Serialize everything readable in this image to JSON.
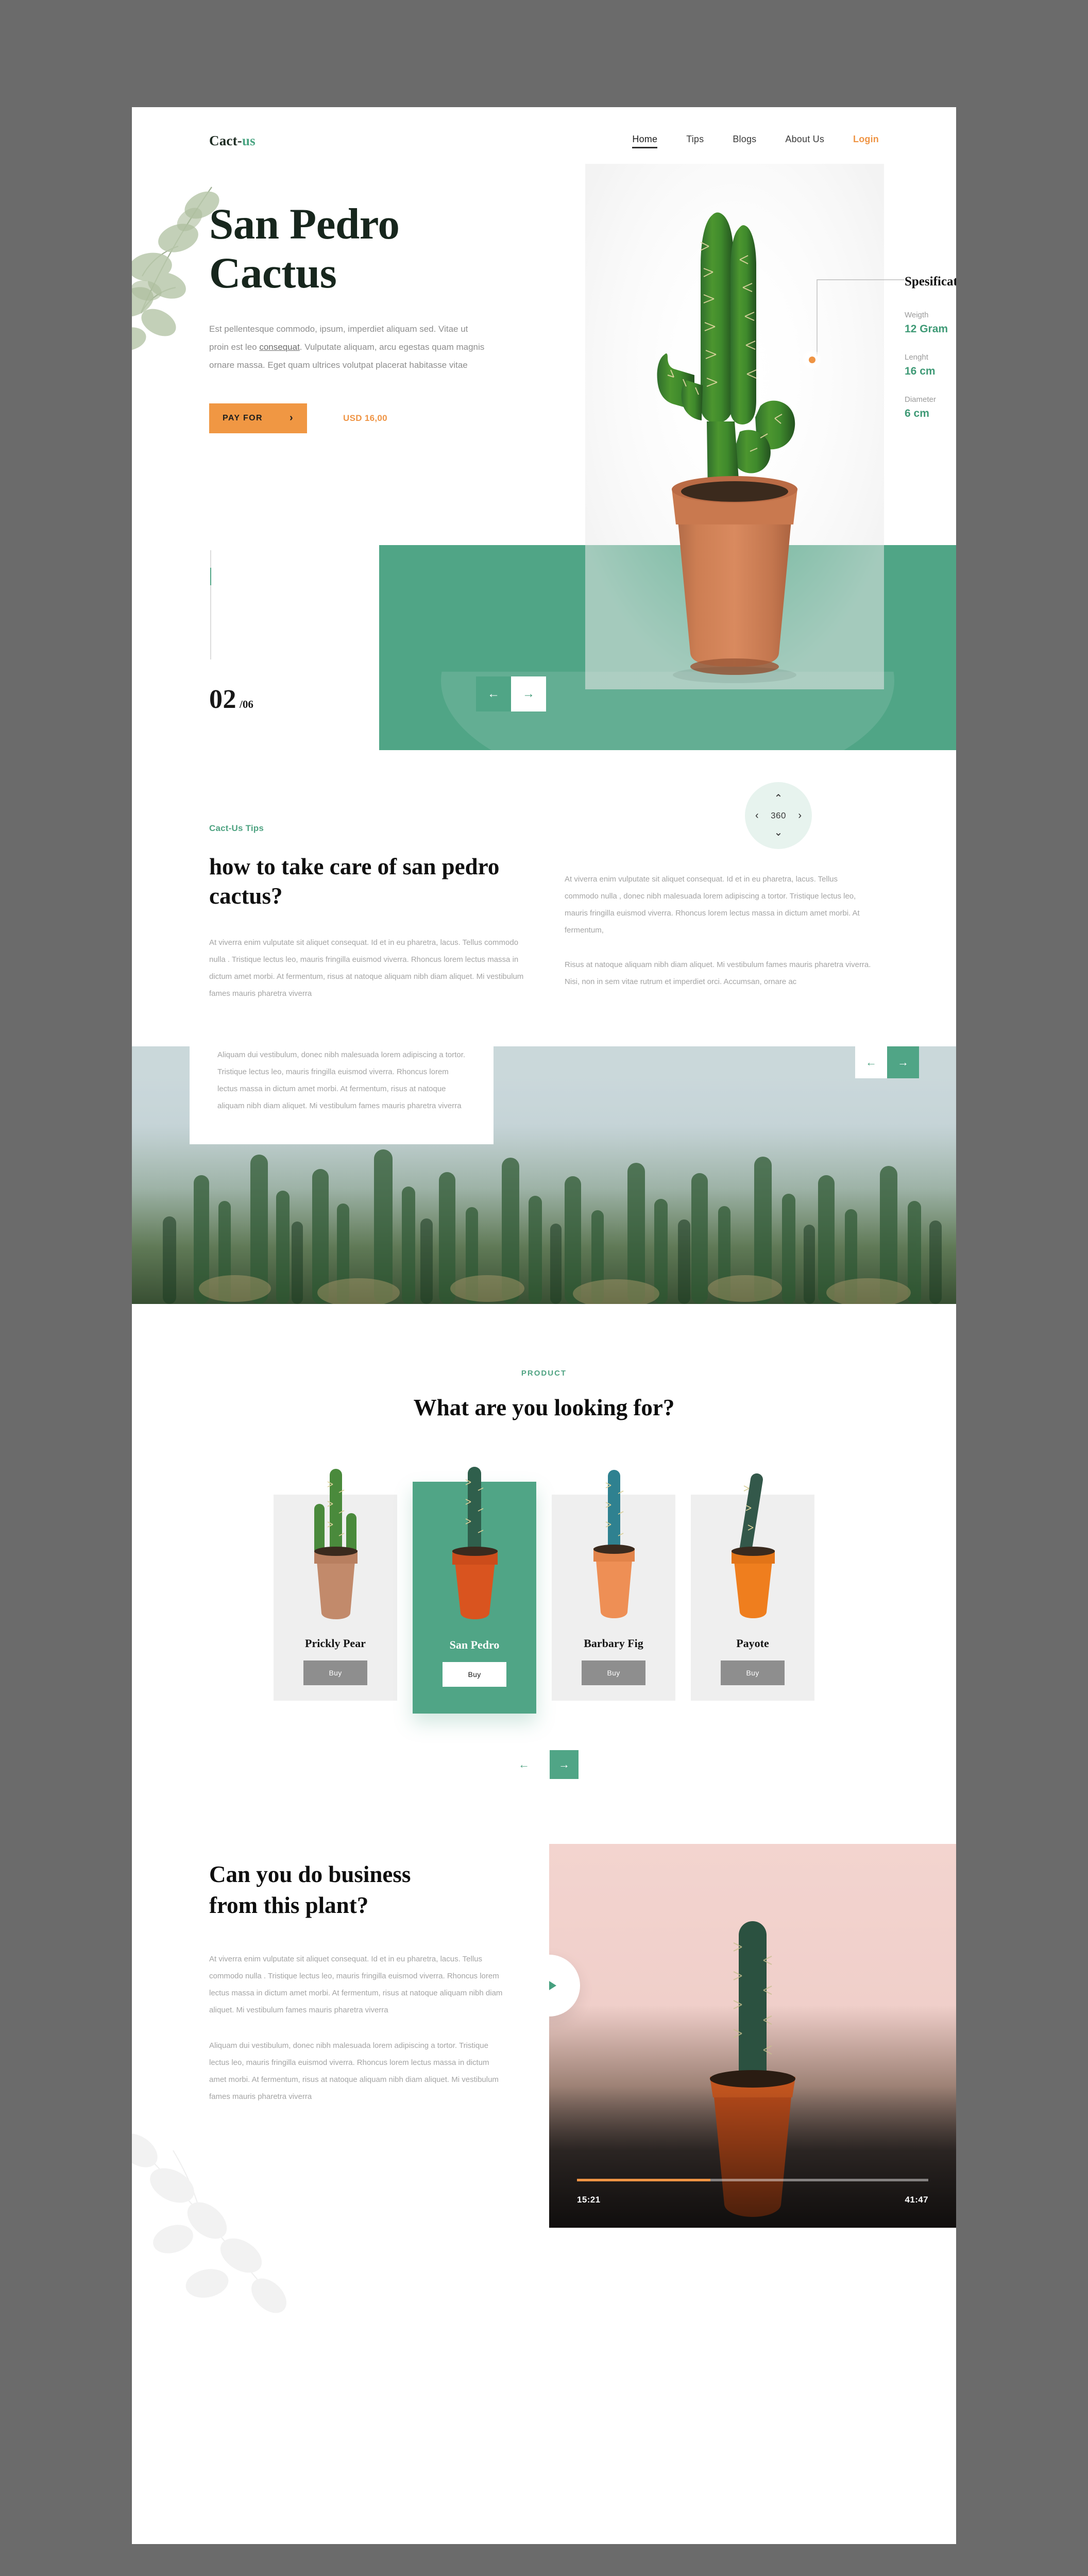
{
  "header": {
    "logo_main": "Cact-",
    "logo_accent": "us",
    "nav": [
      {
        "label": "Home",
        "active": true
      },
      {
        "label": "Tips",
        "active": false
      },
      {
        "label": "Blogs",
        "active": false
      },
      {
        "label": "About Us",
        "active": false
      },
      {
        "label": "Login",
        "active": false
      }
    ]
  },
  "hero": {
    "title_line1": "San Pedro",
    "title_line2": "Cactus",
    "description_before": "Est pellentesque commodo, ipsum, imperdiet aliquam sed. Vitae ut proin est leo ",
    "description_link": "consequat",
    "description_after": ". Vulputate aliquam, arcu egestas quam magnis ornare massa. Eget quam ultrices volutpat placerat habitasse vitae",
    "cta_label": "PAY FOR",
    "cta_chevron": "›",
    "price": "USD 16,00"
  },
  "spec": {
    "title": "Spesification",
    "rows": [
      {
        "label": "Weigth",
        "value": "12 Gram"
      },
      {
        "label": "Lenght",
        "value": "16 cm"
      },
      {
        "label": "Diameter",
        "value": "6 cm"
      }
    ]
  },
  "slider": {
    "current": "02",
    "total": "/06",
    "prev_icon": "←",
    "next_icon": "→"
  },
  "dial": {
    "value": "360",
    "up": "⌃",
    "down": "⌄",
    "left": "‹",
    "right": "›"
  },
  "tips": {
    "eyebrow": "Cact-Us Tips",
    "heading": "how to take care of san pedro cactus?",
    "left_paragraph": "At viverra enim vulputate sit aliquet consequat. Id et in eu pharetra, lacus. Tellus commodo nulla . Tristique lectus leo, mauris fringilla euismod viverra. Rhoncus lorem lectus massa in dictum amet morbi. At fermentum, risus at natoque aliquam nibh diam aliquet. Mi vestibulum fames mauris pharetra viverra",
    "right_paragraph_1": "At viverra enim vulputate sit aliquet consequat. Id et in eu pharetra, lacus. Tellus commodo nulla , donec nibh malesuada lorem adipiscing a tortor. Tristique lectus leo, mauris fringilla euismod viverra. Rhoncus lorem lectus massa in dictum amet morbi. At fermentum,",
    "right_paragraph_2": "Risus at natoque aliquam nibh diam aliquet. Mi vestibulum fames mauris pharetra viverra. Nisi, non in sem vitae rutrum et imperdiet orci. Accumsan, ornare ac",
    "overlay_paragraph": "Aliquam dui vestibulum, donec nibh malesuada lorem adipiscing a tortor. Tristique lectus leo, mauris fringilla euismod viverra. Rhoncus lorem lectus massa in dictum amet morbi. At fermentum, risus at natoque aliquam nibh diam aliquet. Mi vestibulum fames mauris pharetra viverra",
    "prev_icon": "←",
    "next_icon": "→"
  },
  "product": {
    "eyebrow": "PRODUCT",
    "heading": "What are you looking for?",
    "cards": [
      {
        "name": "Prickly Pear",
        "buy_label": "Buy",
        "active": false,
        "pot": "#c28a6b",
        "plant": "#4a8a3c"
      },
      {
        "name": "San Pedro",
        "buy_label": "Buy",
        "active": true,
        "pot": "#d9541f",
        "plant": "#2f5f4c"
      },
      {
        "name": "Barbary Fig",
        "buy_label": "Buy",
        "active": false,
        "pot": "#ee8f55",
        "plant": "#2f8190"
      },
      {
        "name": "Payote",
        "buy_label": "Buy",
        "active": false,
        "pot": "#ef7e1e",
        "plant": "#33584a"
      }
    ],
    "prev_icon": "←",
    "next_icon": "→"
  },
  "business": {
    "heading": "Can you do business from this plant?",
    "paragraph_1": "At viverra enim vulputate sit aliquet consequat. Id et in eu pharetra, lacus. Tellus commodo nulla . Tristique lectus leo, mauris fringilla euismod viverra. Rhoncus lorem lectus massa in dictum amet morbi. At fermentum, risus at natoque aliquam nibh diam aliquet. Mi vestibulum fames mauris pharetra viverra",
    "paragraph_2": "Aliquam dui vestibulum, donec nibh malesuada lorem adipiscing a tortor. Tristique lectus leo, mauris fringilla euismod viverra. Rhoncus lorem lectus massa in dictum amet morbi. At fermentum, risus at natoque aliquam nibh diam aliquet. Mi vestibulum fames mauris pharetra viverra",
    "video": {
      "current_time": "15:21",
      "total_time": "41:47",
      "progress_percent": 38
    }
  },
  "colors": {
    "green": "#50a586",
    "green_text": "#3f9a76",
    "orange": "#ef9444",
    "orange_btn": "#f09743",
    "dark": "#17261d",
    "muted": "#a4a4a4"
  }
}
